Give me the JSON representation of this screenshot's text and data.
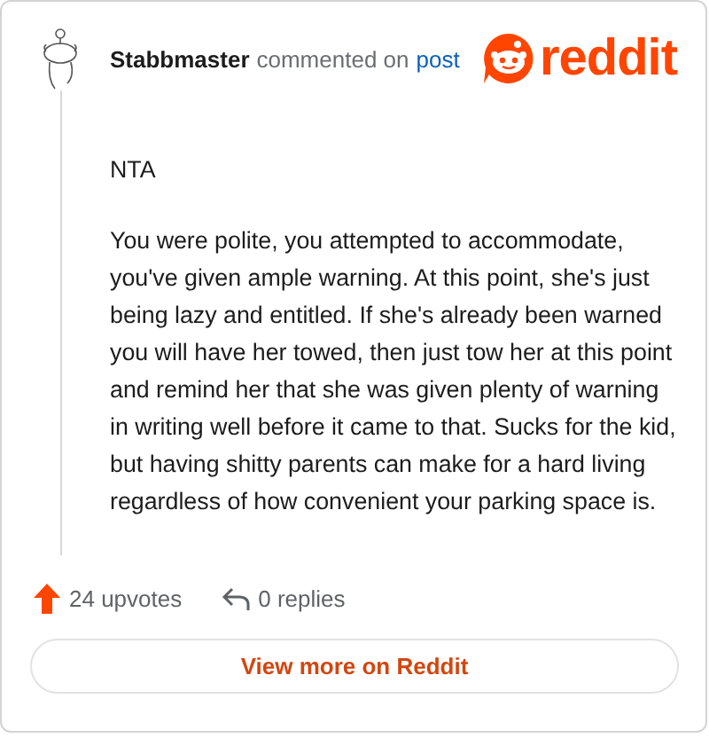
{
  "header": {
    "author": "Stabbmaster",
    "action": "commented on",
    "link": "post"
  },
  "logo": {
    "text": "reddit"
  },
  "comment": {
    "paragraphs": [
      "NTA",
      "You were polite, you attempted to accommodate, you've given ample warning. At this point, she's just being lazy and entitled. If she's already been warned you will have her towed, then just tow her at this point and remind her that she was given plenty of warning in writing well before it came to that. Sucks for the kid, but having shitty parents can make for a hard living regardless of how convenient your parking space is."
    ]
  },
  "stats": {
    "upvotes": "24 upvotes",
    "replies": "0 replies"
  },
  "button": {
    "label": "View more on Reddit"
  }
}
